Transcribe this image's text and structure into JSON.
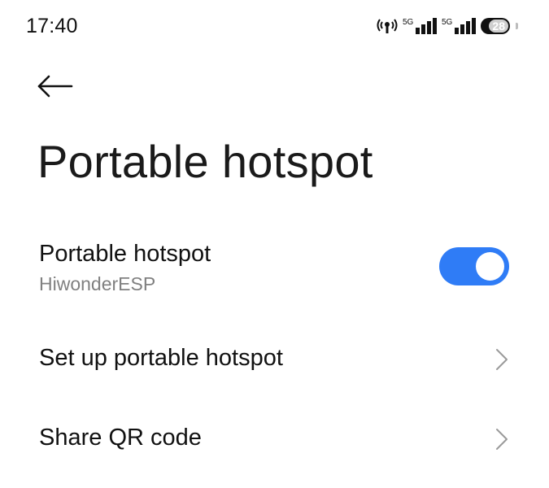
{
  "status_bar": {
    "time": "17:40",
    "network_1": "5G",
    "network_2": "5G",
    "battery": "28",
    "icons": [
      "hotspot-icon",
      "signal-icon",
      "signal-icon",
      "battery-icon"
    ]
  },
  "header": {
    "back_icon": "back-arrow-icon",
    "title": "Portable hotspot"
  },
  "settings": {
    "hotspot": {
      "title": "Portable hotspot",
      "subtitle": "HiwonderESP",
      "enabled": true
    },
    "setup": {
      "title": "Set up portable hotspot"
    },
    "share": {
      "title": "Share QR code"
    }
  },
  "colors": {
    "accent": "#2f7cf6",
    "subtitle": "#808080",
    "chevron": "#9a9a9a"
  }
}
